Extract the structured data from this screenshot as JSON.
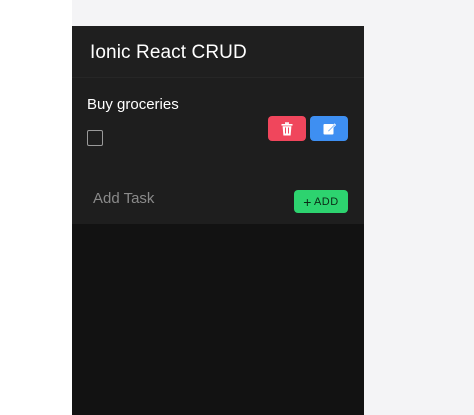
{
  "app": {
    "title": "Ionic React CRUD"
  },
  "tasks": [
    {
      "label": "Buy groceries",
      "checked": false,
      "delete_icon": "trash-icon",
      "edit_icon": "edit-icon"
    }
  ],
  "add_task": {
    "placeholder": "Add Task",
    "value": "",
    "button_label": "ADD",
    "button_icon": "plus"
  },
  "colors": {
    "delete": "#f0465c",
    "edit": "#3e8ff2",
    "add": "#2dd36f",
    "background": "#121212"
  }
}
